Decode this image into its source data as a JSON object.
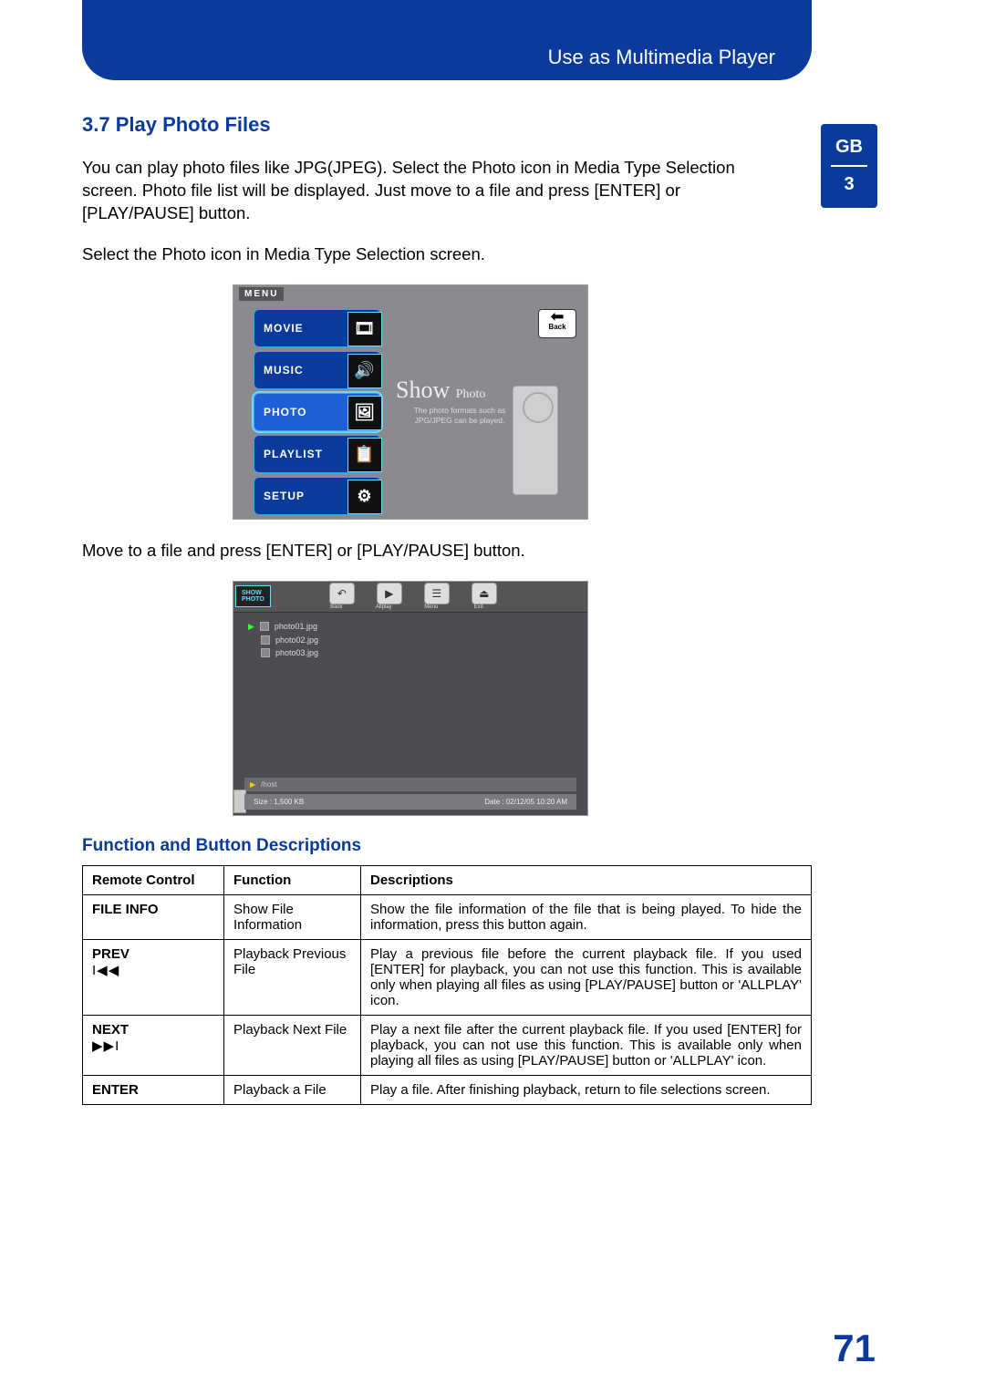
{
  "header": {
    "title": "Use as Multimedia Player"
  },
  "sidetab": {
    "lang": "GB",
    "chapter": "3"
  },
  "section": {
    "heading": "3.7 Play Photo Files",
    "intro": "You can play photo files like JPG(JPEG). Select the Photo icon in Media Type Selection screen. Photo file list will be displayed. Just move to a file and press [ENTER] or [PLAY/PAUSE] button.",
    "step1": "Select the Photo icon in Media Type Selection screen.",
    "step2": "Move to a file and press [ENTER] or [PLAY/PAUSE] button.",
    "subheading": "Function and Button Descriptions"
  },
  "shot1": {
    "menu_label": "MENU",
    "items": [
      "MOVIE",
      "MUSIC",
      "PHOTO",
      "PLAYLIST",
      "SETUP"
    ],
    "back": "Back",
    "show_title": "Show",
    "show_sub": "Photo",
    "show_desc": "The photo formats such as JPG/JPEG can be played."
  },
  "shot2": {
    "badge_line1": "SHOW",
    "badge_line2": "PHOTO",
    "toolbar": [
      "Back",
      "Allplay",
      "Menu",
      "Exit"
    ],
    "files": [
      "photo01.jpg",
      "photo02.jpg",
      "photo03.jpg"
    ],
    "path": "/host",
    "size_label": "Size :",
    "size_value": "1,500 KB",
    "date_label": "Date :",
    "date_value": "02/12/05  10:20  AM"
  },
  "table": {
    "headers": [
      "Remote Control",
      "Function",
      "Descriptions"
    ],
    "rows": [
      {
        "rc": "FILE INFO",
        "sym": "",
        "fn": "Show File Information",
        "desc": "Show the file information of the file that is being played. To hide the information, press this button again."
      },
      {
        "rc": "PREV",
        "sym": "I◀◀",
        "fn": "Playback Previous File",
        "desc": "Play a previous file before the current playback file. If you used [ENTER] for playback, you can not use this function. This is available only when playing all files as using [PLAY/PAUSE] button or 'ALLPLAY' icon."
      },
      {
        "rc": "NEXT",
        "sym": "▶▶I",
        "fn": "Playback Next File",
        "desc": "Play a next file after the current playback file. If you used [ENTER] for playback, you can not use this function. This is available only when playing all files as using [PLAY/PAUSE] button or 'ALLPLAY' icon."
      },
      {
        "rc": "ENTER",
        "sym": "",
        "fn": "Playback a File",
        "desc": "Play a file. After finishing playback, return to file selections screen."
      }
    ]
  },
  "page_number": "71"
}
